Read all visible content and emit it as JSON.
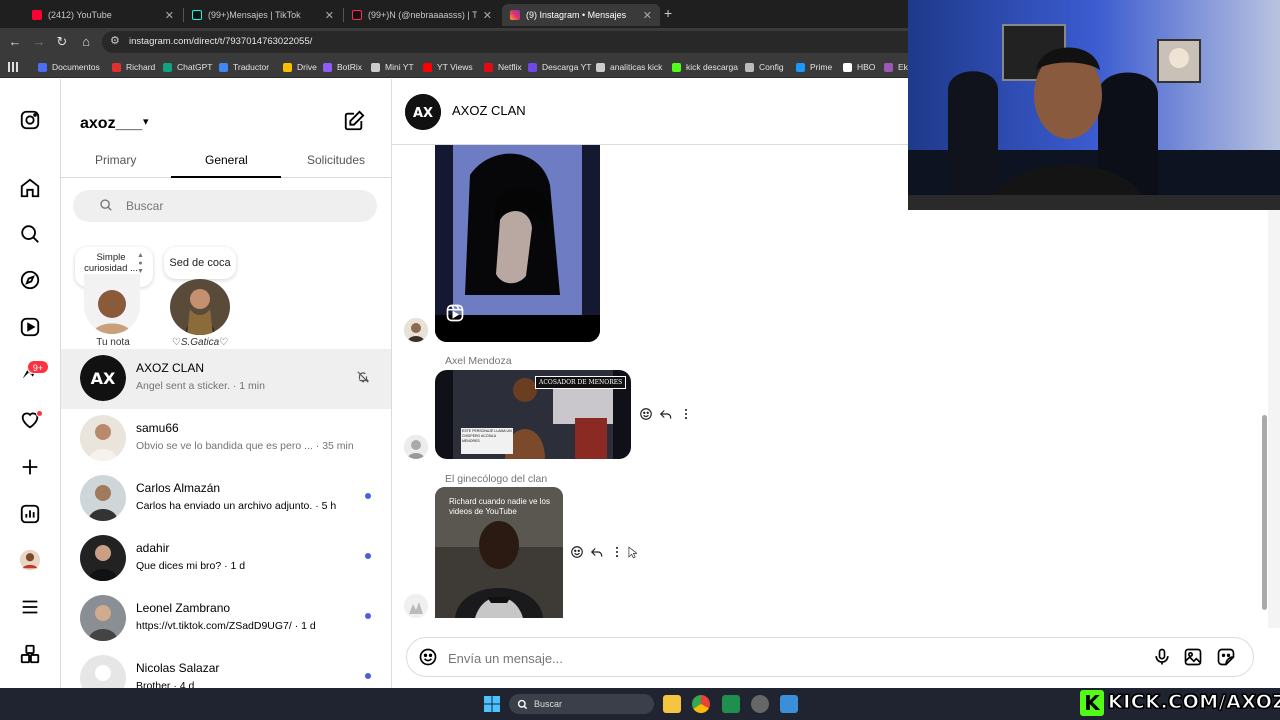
{
  "browser": {
    "tabs": [
      {
        "label": "(2412) YouTube",
        "icon": "youtube-icon",
        "color": "#ff0033"
      },
      {
        "label": "(99+)Mensajes | TikTok",
        "icon": "tiktok-icon",
        "color": "#111111"
      },
      {
        "label": "(99+)N (@nebraaaasss) | TikTok",
        "icon": "tiktok-icon",
        "color": "#111111"
      },
      {
        "label": "(9) Instagram • Mensajes",
        "icon": "instagram-icon",
        "color": "#e1306c"
      }
    ],
    "url": "instagram.com/direct/t/7937014763022055/",
    "bookmarks": [
      {
        "label": "Documentos",
        "color": "#4c6ef5"
      },
      {
        "label": "Richard",
        "color": "#e03131"
      },
      {
        "label": "ChatGPT",
        "color": "#10a37f"
      },
      {
        "label": "Traductor",
        "color": "#4285f4"
      },
      {
        "label": "Drive",
        "color": "#fbbc04"
      },
      {
        "label": "BotRix",
        "color": "#8f5cf7"
      },
      {
        "label": "Mini YT",
        "color": "#cccccc"
      },
      {
        "label": "YT Views",
        "color": "#ff0000"
      },
      {
        "label": "Netflix",
        "color": "#e50914"
      },
      {
        "label": "Descarga YT",
        "color": "#7048e8"
      },
      {
        "label": "analiticas kick",
        "color": "#cccccc"
      },
      {
        "label": "kick descarga",
        "color": "#53fc18"
      },
      {
        "label": "Config",
        "color": "#bbbbbb"
      },
      {
        "label": "Prime",
        "color": "#1a98ff"
      },
      {
        "label": "HBO",
        "color": "#ffffff"
      },
      {
        "label": "Ek",
        "color": "#9b59b6"
      }
    ]
  },
  "inbox": {
    "username": "axoz___",
    "tabs": {
      "primary": "Primary",
      "general": "General",
      "requests": "Solicitudes"
    },
    "search_placeholder": "Buscar",
    "notes": [
      {
        "note_text": "Simple curiosidad ...",
        "label": "Tu nota"
      },
      {
        "note_text": "Sed de coca",
        "label": "♡S.Gatica♡"
      }
    ],
    "threads": [
      {
        "name": "AXOZ CLAN",
        "preview": "Angel sent a sticker. · 1 min",
        "unread": false,
        "muted": true
      },
      {
        "name": "samu66",
        "preview": "Obvio se ve lo bandida que es pero ... · 35 min",
        "unread": false
      },
      {
        "name": "Carlos Almazán",
        "preview": "Carlos ha enviado un archivo adjunto. · 5 h",
        "unread": true
      },
      {
        "name": "adahir",
        "preview": "Que dices mi bro? · 1 d",
        "unread": true
      },
      {
        "name": "Leonel Zambrano",
        "preview": "https://vt.tiktok.com/ZSadD9UG7/ · 1 d",
        "unread": true
      },
      {
        "name": "Nicolas Salazar",
        "preview": "Brother · 4 d",
        "unread": true
      }
    ]
  },
  "nav": {
    "notification_count": "9+"
  },
  "chat": {
    "title": "AXOZ CLAN",
    "avatar_text": "AX",
    "messages": [
      {
        "sender": "",
        "type": "reel"
      },
      {
        "sender": "Axel Mendoza",
        "type": "image",
        "caption": "ACOSADOR DE MENORES",
        "subtext": "ESTE PERSONAJE LLAMA UN CHISPERO ACOSA A MENORES"
      },
      {
        "sender": "El ginecólogo del clan",
        "type": "image",
        "caption": "Richard cuando nadie ve los videos de YouTube"
      }
    ],
    "composer_placeholder": "Envía un mensaje..."
  },
  "taskbar": {
    "search_label": "Buscar"
  },
  "overlay": {
    "kick_text": "KICK.COM/AXOZ",
    "kick_letter": "K"
  },
  "colors": {
    "accent": "#4b5ee8",
    "badge": "#ff3040",
    "kick": "#53fc18"
  }
}
